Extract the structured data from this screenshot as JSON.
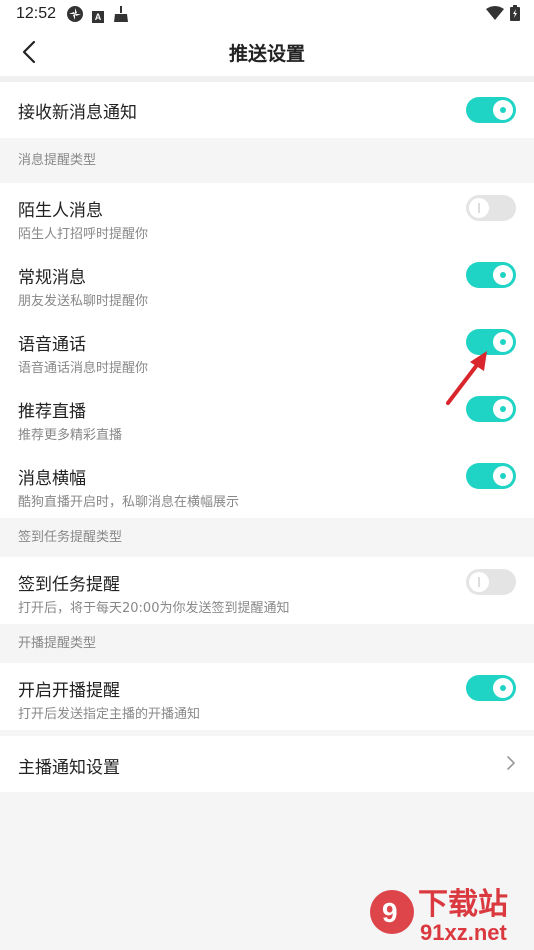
{
  "status_bar": {
    "time": "12:52",
    "icons": [
      "pinwheel-icon",
      "a-icon",
      "broom-icon",
      "wifi-icon",
      "battery-icon"
    ]
  },
  "header": {
    "title": "推送设置"
  },
  "receive_notifications": {
    "label": "接收新消息通知",
    "enabled": true
  },
  "sections": {
    "message_types": {
      "header": "消息提醒类型",
      "items": [
        {
          "title": "陌生人消息",
          "subtitle": "陌生人打招呼时提醒你",
          "enabled": false
        },
        {
          "title": "常规消息",
          "subtitle": "朋友发送私聊时提醒你",
          "enabled": true
        },
        {
          "title": "语音通话",
          "subtitle": "语音通话消息时提醒你",
          "enabled": true
        },
        {
          "title": "推荐直播",
          "subtitle": "推荐更多精彩直播",
          "enabled": true
        },
        {
          "title": "消息横幅",
          "subtitle": "酷狗直播开启时，私聊消息在横幅展示",
          "enabled": true
        }
      ]
    },
    "checkin": {
      "header": "签到任务提醒类型",
      "items": [
        {
          "title": "签到任务提醒",
          "subtitle": "打开后，将于每天20:00为你发送签到提醒通知",
          "enabled": false
        }
      ]
    },
    "live_start": {
      "header": "开播提醒类型",
      "items": [
        {
          "title": "开启开播提醒",
          "subtitle": "打开后发送指定主播的开播通知",
          "enabled": true
        }
      ]
    }
  },
  "anchor_settings": {
    "label": "主播通知设置"
  },
  "watermark": {
    "main": "下载站",
    "domain": "91xz.net"
  },
  "colors": {
    "accent": "#1fd4c4",
    "toggle_off": "#e4e4e4",
    "annotation_arrow": "#d8262c"
  }
}
